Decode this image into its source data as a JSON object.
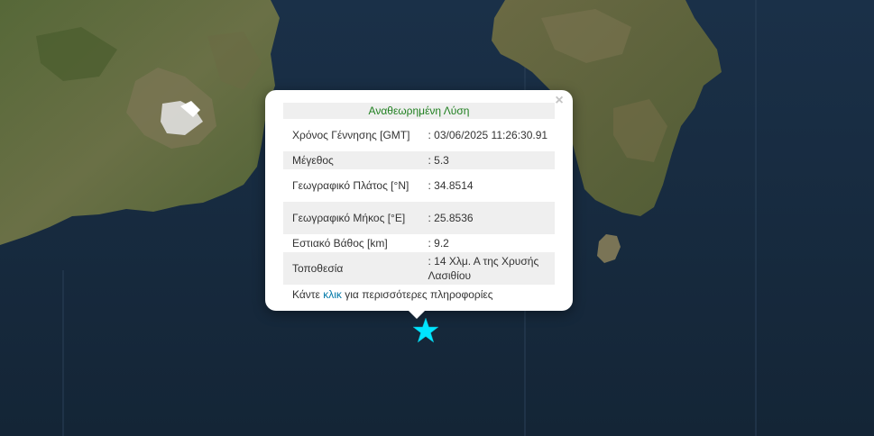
{
  "popup": {
    "close_label": "×",
    "header": "Αναθεωρημένη Λύση",
    "rows": [
      {
        "label": "Χρόνος Γέννησης [GMT]",
        "value": ": 03/06/2025 11:26:30.91"
      },
      {
        "label": "Μέγεθος",
        "value": ": 5.3"
      },
      {
        "label": "Γεωγραφικό Πλάτος [°N]",
        "value": ": 34.8514"
      },
      {
        "label": "Γεωγραφικό Μήκος [°E]",
        "value": ": 25.8536"
      },
      {
        "label": "Εστιακό Βάθος [km]",
        "value": ": 9.2"
      },
      {
        "label": "Τοποθεσία",
        "value": ": 14 Χλμ. Α της Χρυσής Λασιθίου"
      }
    ],
    "more_prefix": "Κάντε",
    "more_link": "κλικ",
    "more_suffix": "για περισσότερες πληροφορίες"
  },
  "marker": {
    "icon": "star-icon",
    "color": "#00e5ff"
  },
  "colors": {
    "sea": "#16283a",
    "land": "#5b6a3a",
    "header_text": "#1f7f1f",
    "link": "#0078a8"
  }
}
